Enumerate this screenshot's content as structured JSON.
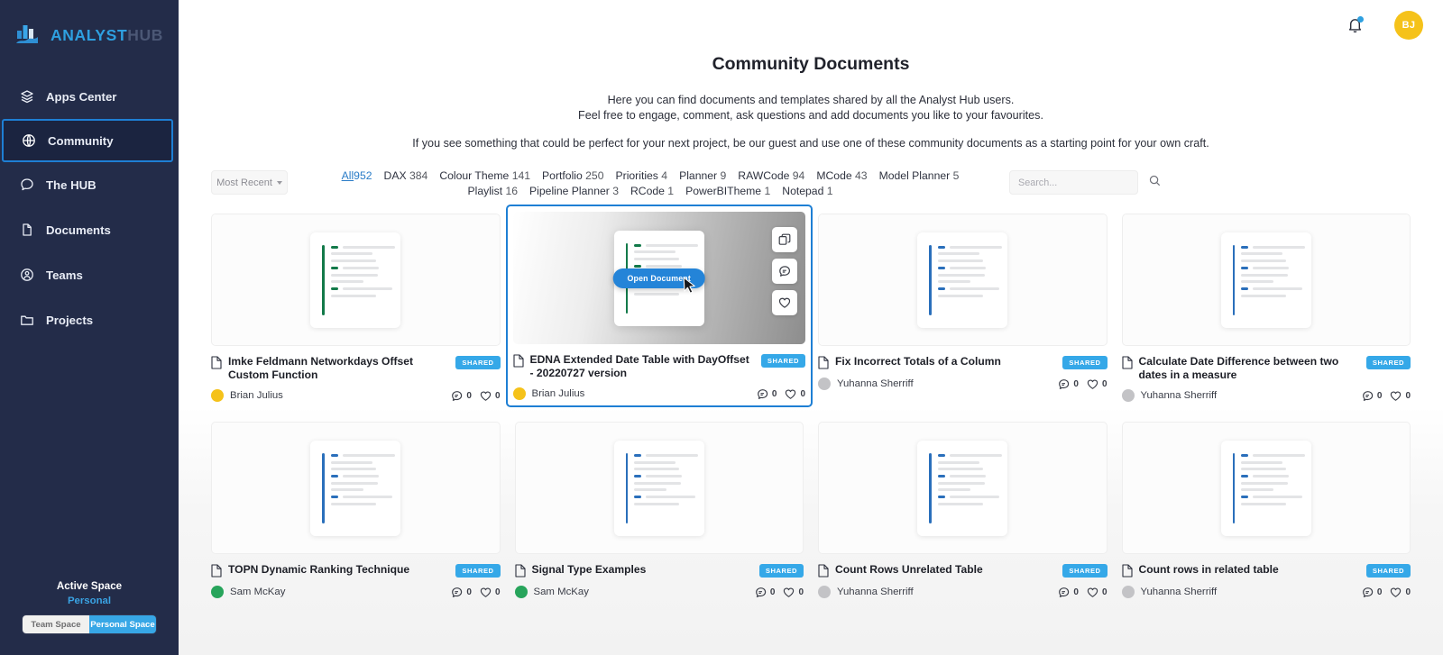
{
  "brand": {
    "name_primary": "ANALYST",
    "name_secondary": "HUB"
  },
  "sidebar": {
    "items": [
      {
        "label": "Apps Center",
        "icon": "layers-icon",
        "active": false
      },
      {
        "label": "Community",
        "icon": "globe-icon",
        "active": true
      },
      {
        "label": "The HUB",
        "icon": "chat-bubble-icon",
        "active": false
      },
      {
        "label": "Documents",
        "icon": "document-icon",
        "active": false
      },
      {
        "label": "Teams",
        "icon": "users-icon",
        "active": false
      },
      {
        "label": "Projects",
        "icon": "folder-icon",
        "active": false
      }
    ],
    "space": {
      "title": "Active Space",
      "value": "Personal",
      "toggle_team": "Team Space",
      "toggle_personal": "Personal Space"
    }
  },
  "topbar": {
    "avatar_initials": "BJ",
    "notification_icon": "bell-icon"
  },
  "header": {
    "title": "Community Documents",
    "line1": "Here you can find documents and templates shared by all the Analyst Hub users.",
    "line2": "Feel free to engage, comment, ask questions and add documents you like to your favourites.",
    "line3": "If you see something that could be perfect for your next project, be our guest and use one of these community documents as a starting point for your own craft."
  },
  "filters": {
    "sort_label": "Most Recent",
    "tags": [
      {
        "label": "All",
        "count": "952",
        "active": true
      },
      {
        "label": "DAX",
        "count": "384",
        "active": false
      },
      {
        "label": "Colour Theme",
        "count": "141",
        "active": false
      },
      {
        "label": "Portfolio",
        "count": "250",
        "active": false
      },
      {
        "label": "Priorities",
        "count": "4",
        "active": false
      },
      {
        "label": "Planner",
        "count": "9",
        "active": false
      },
      {
        "label": "RAWCode",
        "count": "94",
        "active": false
      },
      {
        "label": "MCode",
        "count": "43",
        "active": false
      },
      {
        "label": "Model Planner",
        "count": "5",
        "active": false
      },
      {
        "label": "Playlist",
        "count": "16",
        "active": false
      },
      {
        "label": "Pipeline Planner",
        "count": "3",
        "active": false
      },
      {
        "label": "RCode",
        "count": "1",
        "active": false
      },
      {
        "label": "PowerBITheme",
        "count": "1",
        "active": false
      },
      {
        "label": "Notepad",
        "count": "1",
        "active": false
      }
    ],
    "search_placeholder": "Search..."
  },
  "hover_card": {
    "open_button": "Open Document",
    "actions": [
      "copy-icon",
      "comment-icon",
      "heart-icon"
    ]
  },
  "cards": [
    {
      "title": "Imke Feldmann Networkdays Offset Custom Function",
      "badge": "SHARED",
      "author": "Brian Julius",
      "avatar_color": "#f5c21a",
      "accent": "#137a4a",
      "comments": "0",
      "likes": "0",
      "hovered": false
    },
    {
      "title": "EDNA Extended Date Table with DayOffset - 20220727 version",
      "badge": "SHARED",
      "author": "Brian Julius",
      "avatar_color": "#f5c21a",
      "accent": "#137a4a",
      "comments": "0",
      "likes": "0",
      "hovered": true
    },
    {
      "title": "Fix Incorrect Totals of a Column",
      "badge": "SHARED",
      "author": "Yuhanna Sherriff",
      "avatar_color": "#c3c3c6",
      "accent": "#2a6fbb",
      "comments": "0",
      "likes": "0",
      "hovered": false
    },
    {
      "title": "Calculate Date Difference between two dates in a measure",
      "badge": "SHARED",
      "author": "Yuhanna Sherriff",
      "avatar_color": "#c3c3c6",
      "accent": "#2a6fbb",
      "comments": "0",
      "likes": "0",
      "hovered": false
    },
    {
      "title": "TOPN Dynamic Ranking Technique",
      "badge": "SHARED",
      "author": "Sam McKay",
      "avatar_color": "#27a45b",
      "accent": "#2a6fbb",
      "comments": "0",
      "likes": "0",
      "hovered": false
    },
    {
      "title": "Signal Type Examples",
      "badge": "SHARED",
      "author": "Sam McKay",
      "avatar_color": "#27a45b",
      "accent": "#2a6fbb",
      "comments": "0",
      "likes": "0",
      "hovered": false
    },
    {
      "title": "Count Rows Unrelated Table",
      "badge": "SHARED",
      "author": "Yuhanna Sherriff",
      "avatar_color": "#c3c3c6",
      "accent": "#2a6fbb",
      "comments": "0",
      "likes": "0",
      "hovered": false
    },
    {
      "title": "Count rows in related table",
      "badge": "SHARED",
      "author": "Yuhanna Sherriff",
      "avatar_color": "#c3c3c6",
      "accent": "#2a6fbb",
      "comments": "0",
      "likes": "0",
      "hovered": false
    }
  ],
  "colors": {
    "sidebar_bg": "#232c49",
    "accent_blue": "#2ea0e0",
    "active_border": "#1e7fd4",
    "badge_blue": "#35a8e8"
  }
}
